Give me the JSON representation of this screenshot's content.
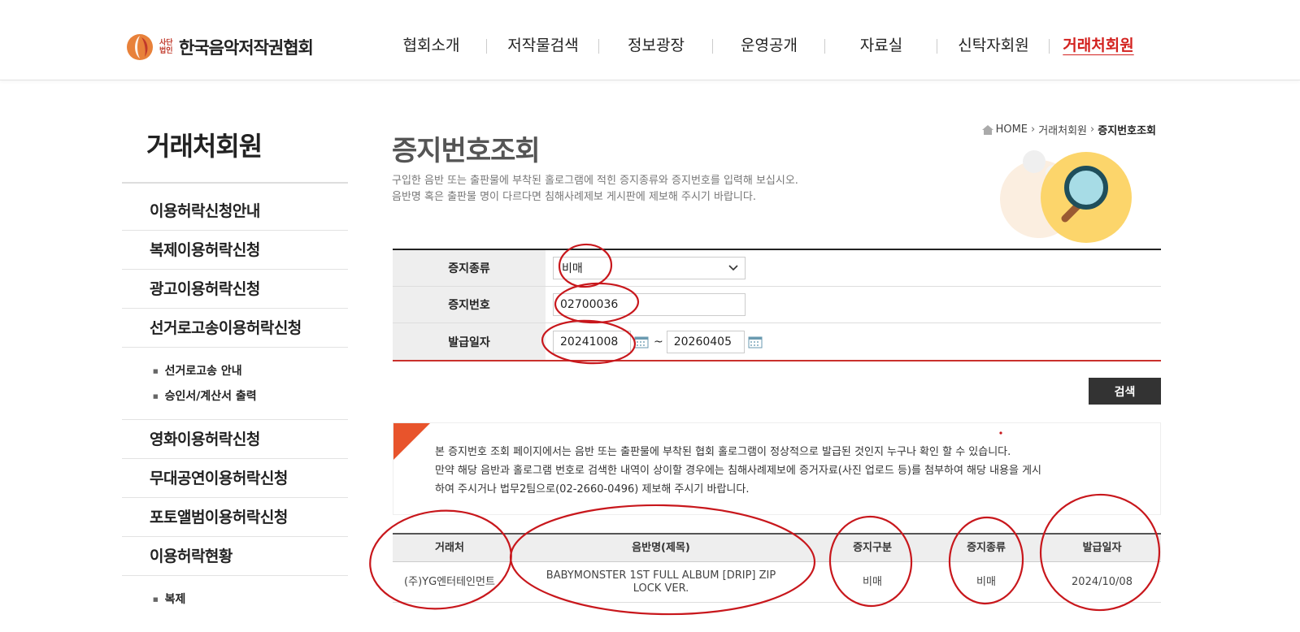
{
  "header": {
    "logo": {
      "sub": "사단법인",
      "name": "한국음악저작권협회"
    },
    "nav": [
      {
        "label": "협회소개"
      },
      {
        "label": "저작물검색"
      },
      {
        "label": "정보광장"
      },
      {
        "label": "운영공개"
      },
      {
        "label": "자료실"
      },
      {
        "label": "신탁자회원"
      },
      {
        "label": "거래처회원",
        "active": true
      }
    ]
  },
  "sidebar": {
    "title": "거래처회원",
    "items": [
      "이용허락신청안내",
      "복제이용허락신청",
      "광고이용허락신청",
      "선거로고송이용허락신청"
    ],
    "sub_items": [
      "선거로고송 안내",
      "승인서/계산서 출력"
    ],
    "items2": [
      "영화이용허락신청",
      "무대공연이용허락신청",
      "포토앨범이용허락신청",
      "이용허락현황"
    ],
    "sub_items2": [
      "복제"
    ]
  },
  "breadcrumb": {
    "home": "HOME",
    "section": "거래처회원",
    "current": "증지번호조회"
  },
  "page": {
    "title": "증지번호조회",
    "desc_1": "구입한 음반 또는 출판물에 부착된 홀로그램에 적힌 증지종류와 증지번호를 입력해 보십시오.",
    "desc_2": "음반명 혹은 출판물 명이 다르다면 침해사례제보 게시판에 제보해 주시기 바랍니다."
  },
  "form": {
    "type_label": "증지종류",
    "type_value": "비매",
    "number_label": "증지번호",
    "number_value": "02700036",
    "date_label": "발급일자",
    "date_from": "20241008",
    "date_sep": "~",
    "date_to": "20260405",
    "search_label": "검색"
  },
  "notice": {
    "line_1": "본 증지번호 조회 페이지에서는 음반 또는 출판물에 부착된 협회 홀로그램이 정상적으로 발급된 것인지 누구나 확인 할 수 있습니다.",
    "line_2": "만약 해당 음반과 홀로그램 번호로 검색한 내역이 상이할 경우에는 침해사례제보에 증거자료(사진 업로드 등)를 첨부하여 해당 내용을 게시",
    "line_3": "하여 주시거나 법무2팀으로(02-2660-0496) 제보해 주시기 바랍니다."
  },
  "results": {
    "headers": [
      "거래처",
      "음반명(제목)",
      "증지구분",
      "증지종류",
      "발급일자"
    ],
    "rows": [
      {
        "client": "(주)YG엔터테인먼트",
        "album": "BABYMONSTER 1ST FULL ALBUM [DRIP] ZIP LOCK VER.",
        "category": "비매",
        "type": "비매",
        "date": "2024/10/08"
      }
    ]
  },
  "colors": {
    "accent_red": "#d3221f",
    "annotation_red": "#c8171c",
    "notice_corner": "#e8542c",
    "button_dark": "#333333"
  }
}
